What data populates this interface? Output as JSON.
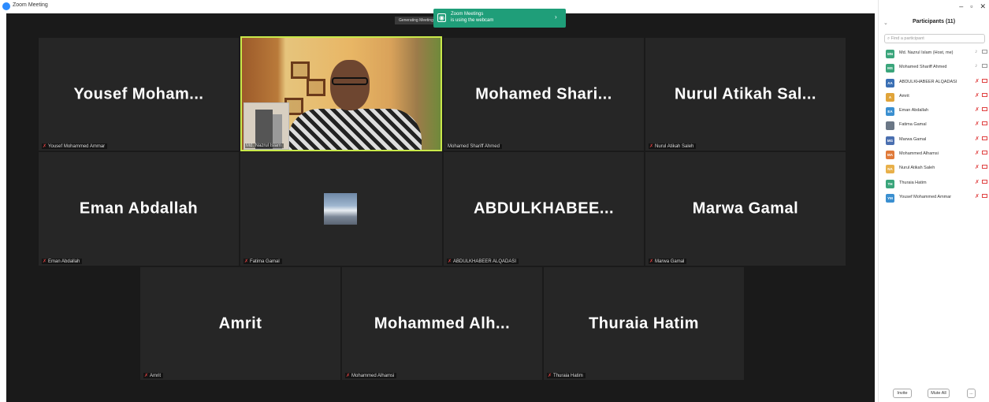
{
  "window": {
    "title": "Zoom Meeting"
  },
  "recording_label": "Generating Meeting...",
  "toast": {
    "title": "Zoom Meetings",
    "message": "is using the webcam",
    "icon": "webcam-icon"
  },
  "tiles": {
    "t1": {
      "big": "Yousef  Moham...",
      "small": "Yousef Mohammed Ammar"
    },
    "t2": {
      "small": "Md. Nazrul Islam"
    },
    "t3": {
      "big": "Mohamed  Shari...",
      "small": "Mohamed Shariff Ahmed"
    },
    "t4": {
      "big": "Nurul  Atikah  Sal...",
      "small": "Nurul Atikah Saleh"
    },
    "t5": {
      "big": "Eman Abdallah",
      "small": "Eman Abdallah"
    },
    "t6": {
      "small": "Fatima Gamal"
    },
    "t7": {
      "big": "ABDULKHABEE...",
      "small": "ABDULKHABEER ALQADASI"
    },
    "t8": {
      "big": "Marwa Gamal",
      "small": "Marwa Gamal"
    },
    "t9": {
      "big": "Amrit",
      "small": "Amrit"
    },
    "t10": {
      "big": "Mohammed  Alh...",
      "small": "Mohammed Alhamsi"
    },
    "t11": {
      "big": "Thuraia Hatim",
      "small": "Thuraia Hatim"
    }
  },
  "panel": {
    "title": "Participants (11)",
    "search_placeholder": "Find a participant",
    "participants": [
      {
        "initials": "MN",
        "name": "Md. Nazrul Islam (Host, me)",
        "color": "#3aa57b",
        "mic": "on"
      },
      {
        "initials": "MS",
        "name": "Mohamed Shariff Ahmed",
        "color": "#3aa57b",
        "mic": "on"
      },
      {
        "initials": "AA",
        "name": "ABDULKHABEER ALQADASI",
        "color": "#3a6fb4",
        "mic": "muted"
      },
      {
        "initials": "A",
        "name": "Amrit",
        "color": "#e0a43a",
        "mic": "muted"
      },
      {
        "initials": "EA",
        "name": "Eman Abdallah",
        "color": "#3a8fd0",
        "mic": "muted"
      },
      {
        "initials": "",
        "name": "Fatima Gamal",
        "color": "#6b7786",
        "mic": "muted"
      },
      {
        "initials": "MG",
        "name": "Marwa Gamal",
        "color": "#4a6fb0",
        "mic": "muted"
      },
      {
        "initials": "MA",
        "name": "Mohammed Alhamsi",
        "color": "#e07a3a",
        "mic": "muted"
      },
      {
        "initials": "NA",
        "name": "Nurul Atikah Saleh",
        "color": "#e8b04a",
        "mic": "muted"
      },
      {
        "initials": "TH",
        "name": "Thuraia Hatim",
        "color": "#3aa57b",
        "mic": "muted"
      },
      {
        "initials": "YM",
        "name": "Yousef Mohammed Ammar",
        "color": "#3a8fd0",
        "mic": "muted"
      }
    ],
    "invite_label": "Invite",
    "mute_all_label": "Mute All",
    "more_label": "..."
  }
}
